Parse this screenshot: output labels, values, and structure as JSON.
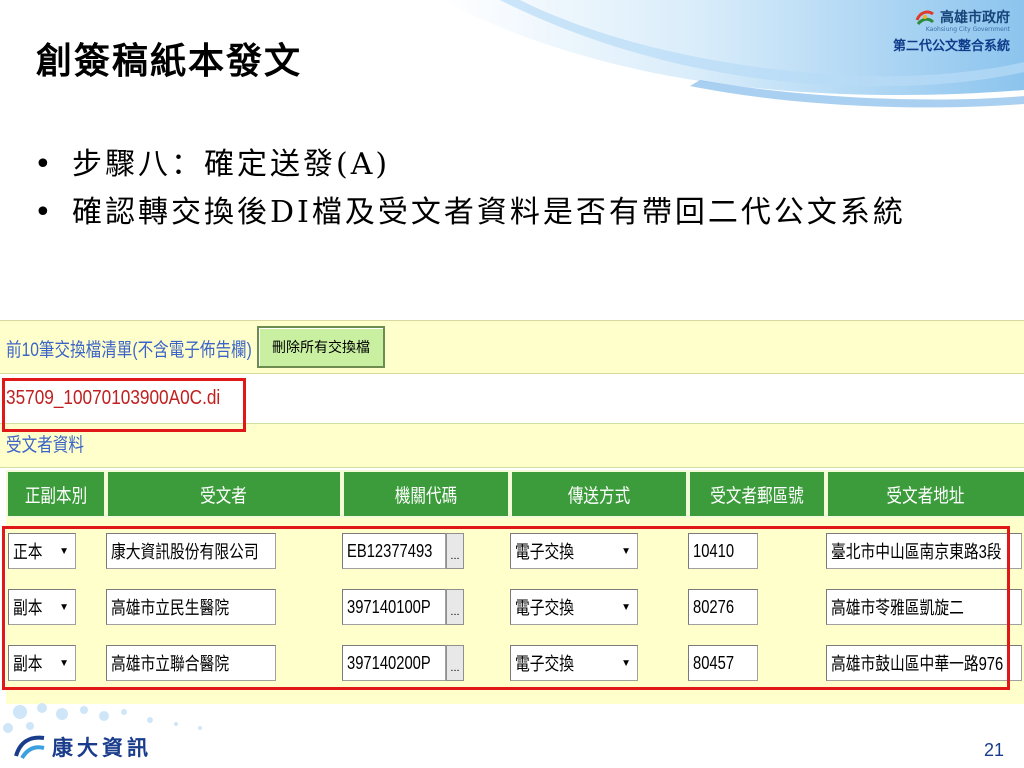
{
  "header": {
    "org_name": "高雄市政府",
    "org_english": "Kaohsiung City Government",
    "system_name": "第二代公文整合系統"
  },
  "title": "創簽稿紙本發文",
  "bullets": [
    "步驟八：確定送發(A)",
    "確認轉交換後DI檔及受文者資料是否有帶回二代公文系統"
  ],
  "screenshot": {
    "list_label": "前10筆交換檔清單(不含電子佈告欄)",
    "delete_button": "刪除所有交換檔",
    "file_name": "35709_10070103900A0C.di",
    "recipient_label": "受文者資料",
    "columns": [
      "正副本別",
      "受文者",
      "機關代碼",
      "傳送方式",
      "受文者郵區號",
      "受文者地址"
    ],
    "rows": [
      {
        "copy_type": "正本",
        "recipient": "康大資訊股份有限公司",
        "agency_code": "EB12377493",
        "method": "電子交換",
        "zip": "10410",
        "address": "臺北市中山區南京東路3段"
      },
      {
        "copy_type": "副本",
        "recipient": "高雄市立民生醫院",
        "agency_code": "397140100P",
        "method": "電子交換",
        "zip": "80276",
        "address": "高雄市苓雅區凱旋二"
      },
      {
        "copy_type": "副本",
        "recipient": "高雄市立聯合醫院",
        "agency_code": "397140200P",
        "method": "電子交換",
        "zip": "80457",
        "address": "高雄市鼓山區中華一路976"
      }
    ],
    "more_button": "..."
  },
  "footer": {
    "brand": "康大資訊",
    "page_number": "21"
  },
  "colors": {
    "header_green": "#3c9c3c",
    "panel_yellow": "#ffffcc",
    "highlight_red": "#e01818",
    "link_blue": "#3c64c8"
  }
}
